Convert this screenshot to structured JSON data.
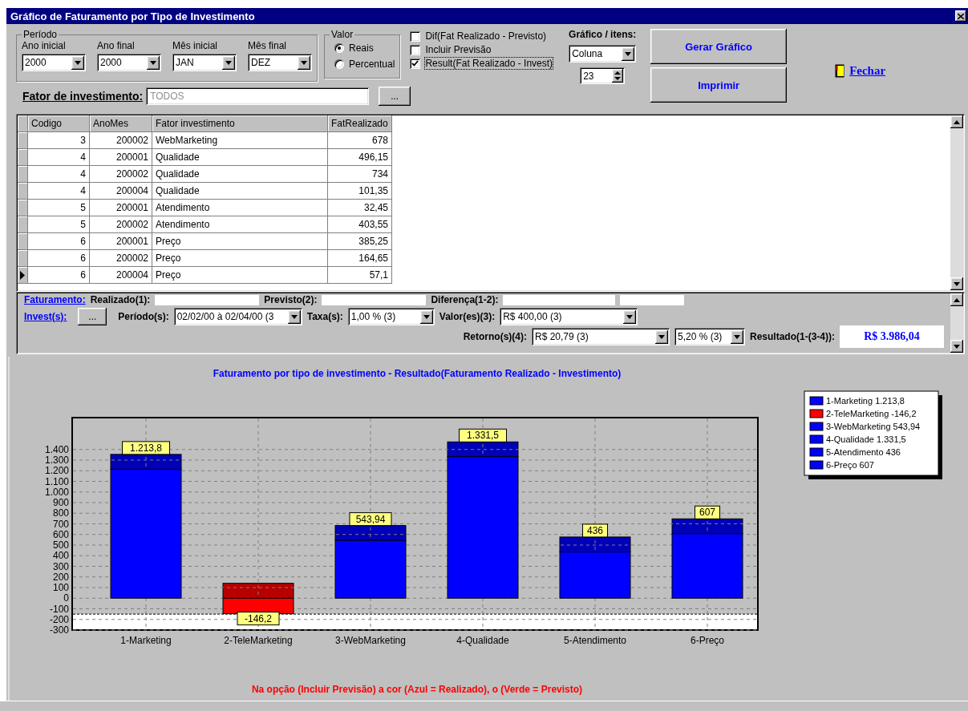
{
  "window": {
    "title": "Gráfico de Faturamento por Tipo de Investimento"
  },
  "periodo": {
    "legend": "Período",
    "fields": [
      {
        "label": "Ano inicial",
        "value": "2000"
      },
      {
        "label": "Ano final",
        "value": "2000"
      },
      {
        "label": "Mês inicial",
        "value": "JAN"
      },
      {
        "label": "Mês final",
        "value": "DEZ"
      }
    ]
  },
  "valor": {
    "legend": "Valor",
    "options": [
      {
        "label": "Reais",
        "selected": true
      },
      {
        "label": "Percentual",
        "selected": false
      }
    ]
  },
  "checkboxes": [
    {
      "label": "Dif(Fat Realizado - Previsto)",
      "checked": false,
      "focused": false
    },
    {
      "label": "Incluir Previsão",
      "checked": false,
      "focused": false
    },
    {
      "label": "Result(Fat Realizado - Invest)",
      "checked": true,
      "focused": true
    }
  ],
  "grafico": {
    "label": "Gráfico / itens:",
    "type": "Coluna",
    "items": "23"
  },
  "buttons": [
    "Gerar Gráfico",
    "Imprimir"
  ],
  "close_link": "Fechar",
  "fator": {
    "label": "Fator de investimento:",
    "placeholder": "TODOS",
    "button": "..."
  },
  "table": {
    "columns": [
      "Codigo",
      "AnoMes",
      "Fator investimento",
      "FatRealizado"
    ],
    "rows": [
      {
        "cells": [
          "3",
          "200002",
          "WebMarketing",
          "678"
        ],
        "selected": false
      },
      {
        "cells": [
          "4",
          "200001",
          "Qualidade",
          "496,15"
        ],
        "selected": false
      },
      {
        "cells": [
          "4",
          "200002",
          "Qualidade",
          "734"
        ],
        "selected": false
      },
      {
        "cells": [
          "4",
          "200004",
          "Qualidade",
          "101,35"
        ],
        "selected": false
      },
      {
        "cells": [
          "5",
          "200001",
          "Atendimento",
          "32,45"
        ],
        "selected": false
      },
      {
        "cells": [
          "5",
          "200002",
          "Atendimento",
          "403,55"
        ],
        "selected": false
      },
      {
        "cells": [
          "6",
          "200001",
          "Preço",
          "385,25"
        ],
        "selected": false
      },
      {
        "cells": [
          "6",
          "200002",
          "Preço",
          "164,65"
        ],
        "selected": false
      },
      {
        "cells": [
          "6",
          "200004",
          "Preço",
          "57,1"
        ],
        "selected": true
      }
    ]
  },
  "summary": {
    "faturamento_link": "Faturamento:",
    "faturamento_labels": [
      "Realizado(1):",
      "Previsto(2):",
      "Diferença(1-2):"
    ],
    "invest_link": "Invest(s):",
    "invest_button": "...",
    "periodos": {
      "label": "Período(s):",
      "value": "02/02/00 à 02/04/00 (3"
    },
    "taxas": {
      "label": "Taxa(s):",
      "value": "1,00 % (3)"
    },
    "valores": {
      "label": "Valor(es)(3):",
      "value": "R$ 400,00 (3)"
    },
    "retornos": {
      "label": "Retorno(s)(4):",
      "value": "R$ 20,79 (3)",
      "rate": "5,20 % (3)"
    },
    "resultado": {
      "label": "Resultado(1-(3-4)):",
      "value": "R$ 3.986,04"
    }
  },
  "chart": {
    "title": "Faturamento por tipo de investimento -  Resultado(Faturamento Realizado - Investimento)",
    "legend": [
      {
        "label": "1-Marketing 1.213,8",
        "color": "#0000ff"
      },
      {
        "label": "2-TeleMarketing -146,2",
        "color": "#ff0000"
      },
      {
        "label": "3-WebMarketing 543,94",
        "color": "#0000ff"
      },
      {
        "label": "4-Qualidade 1.331,5",
        "color": "#0000ff"
      },
      {
        "label": "5-Atendimento 436",
        "color": "#0000ff"
      },
      {
        "label": "6-Preço 607",
        "color": "#0000ff"
      }
    ],
    "chart_data": {
      "type": "bar",
      "categories": [
        "1-Marketing",
        "2-TeleMarketing",
        "3-WebMarketing",
        "4-Qualidade",
        "5-Atendimento",
        "6-Preço"
      ],
      "series": [
        {
          "values": [
            1213.8,
            -146.2,
            543.94,
            1331.5,
            436,
            607
          ]
        }
      ],
      "grid": true,
      "ylim": [
        -300,
        1700
      ],
      "yticks": [
        {
          "value": -300,
          "label": "-300"
        },
        {
          "value": -200,
          "label": "-200"
        },
        {
          "value": -100,
          "label": "-100"
        },
        {
          "value": 0,
          "label": "0"
        },
        {
          "value": 100,
          "label": "100"
        },
        {
          "value": 200,
          "label": "200"
        },
        {
          "value": 300,
          "label": "300"
        },
        {
          "value": 400,
          "label": "400"
        },
        {
          "value": 500,
          "label": "500"
        },
        {
          "value": 600,
          "label": "600"
        },
        {
          "value": 700,
          "label": "700"
        },
        {
          "value": 800,
          "label": "800"
        },
        {
          "value": 900,
          "label": "900"
        },
        {
          "value": 1000,
          "label": "1.000"
        },
        {
          "value": 1100,
          "label": "1.100"
        },
        {
          "value": 1200,
          "label": "1.200"
        },
        {
          "value": 1300,
          "label": "1.300"
        },
        {
          "value": 1400,
          "label": "1.400"
        }
      ],
      "value_labels": [
        "1.213,8",
        "-146,2",
        "543,94",
        "1.331,5",
        "436",
        "607"
      ]
    },
    "note": "Na  opção (Incluir  Previsão) a cor (Azul = Realizado), o (Verde =  Previsto)"
  }
}
